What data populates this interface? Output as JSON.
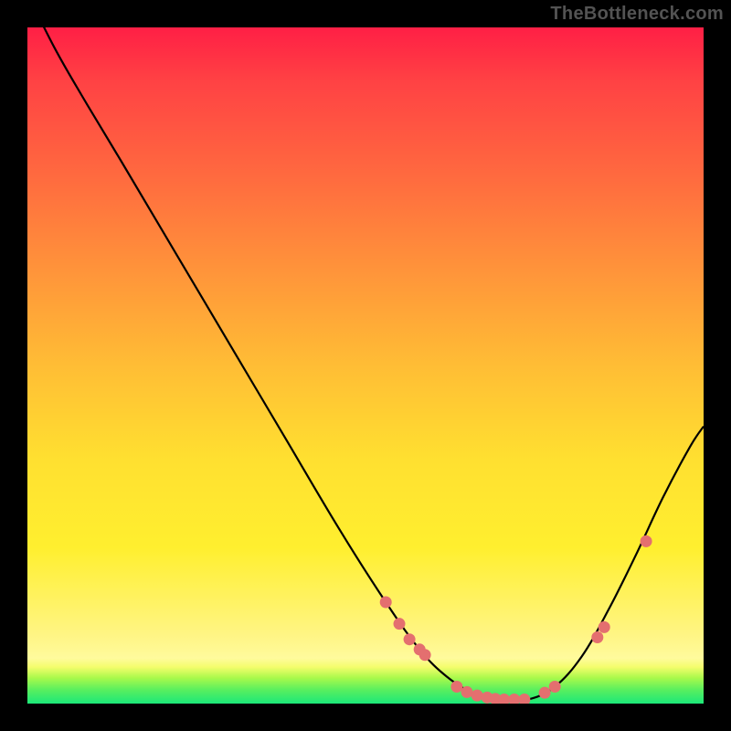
{
  "watermark": "TheBottleneck.com",
  "colors": {
    "dot_fill": "#e46f6f",
    "line_stroke": "#000000"
  },
  "chart_data": {
    "type": "line",
    "title": "",
    "xlabel": "",
    "ylabel": "",
    "xlim": [
      0,
      100
    ],
    "ylim": [
      0,
      100
    ],
    "grid": false,
    "legend": false,
    "series": [
      {
        "name": "curve",
        "x": [
          0,
          4,
          8,
          14,
          22,
          30,
          38,
          46,
          53,
          58,
          62,
          66,
          70,
          74,
          78,
          82,
          86,
          90,
          94,
          98,
          100
        ],
        "y": [
          105,
          97,
          90,
          80,
          66.5,
          53,
          39.5,
          26,
          15,
          8,
          4,
          1.5,
          0.6,
          0.6,
          2.5,
          7,
          14,
          22,
          30.5,
          38,
          41
        ]
      }
    ],
    "dots": [
      {
        "x": 53.0,
        "y": 15.0
      },
      {
        "x": 55.0,
        "y": 11.8
      },
      {
        "x": 56.5,
        "y": 9.5
      },
      {
        "x": 58.0,
        "y": 8.0
      },
      {
        "x": 58.8,
        "y": 7.2
      },
      {
        "x": 63.5,
        "y": 2.5
      },
      {
        "x": 65.0,
        "y": 1.7
      },
      {
        "x": 66.5,
        "y": 1.2
      },
      {
        "x": 68.0,
        "y": 0.9
      },
      {
        "x": 69.2,
        "y": 0.7
      },
      {
        "x": 70.5,
        "y": 0.6
      },
      {
        "x": 72.0,
        "y": 0.6
      },
      {
        "x": 73.5,
        "y": 0.6
      },
      {
        "x": 76.5,
        "y": 1.6
      },
      {
        "x": 78.0,
        "y": 2.5
      },
      {
        "x": 84.3,
        "y": 9.8
      },
      {
        "x": 85.3,
        "y": 11.3
      },
      {
        "x": 91.5,
        "y": 24.0
      }
    ]
  }
}
